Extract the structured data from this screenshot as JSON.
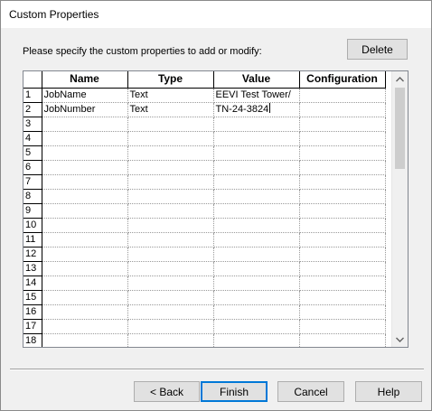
{
  "window": {
    "title": "Custom Properties"
  },
  "prompt": "Please specify the custom properties to add or modify:",
  "buttons": {
    "delete": "Delete",
    "back": "< Back",
    "finish": "Finish",
    "cancel": "Cancel",
    "help": "Help"
  },
  "grid": {
    "columns": [
      "Name",
      "Type",
      "Value",
      "Configuration"
    ],
    "rows": [
      {
        "num": "1",
        "name": "JobName",
        "type": "Text",
        "value": "EEVI Test Tower/",
        "config": ""
      },
      {
        "num": "2",
        "name": "JobNumber",
        "type": "Text",
        "value": "TN-24-3824",
        "config": ""
      },
      {
        "num": "3",
        "name": "",
        "type": "",
        "value": "",
        "config": ""
      },
      {
        "num": "4",
        "name": "",
        "type": "",
        "value": "",
        "config": ""
      },
      {
        "num": "5",
        "name": "",
        "type": "",
        "value": "",
        "config": ""
      },
      {
        "num": "6",
        "name": "",
        "type": "",
        "value": "",
        "config": ""
      },
      {
        "num": "7",
        "name": "",
        "type": "",
        "value": "",
        "config": ""
      },
      {
        "num": "8",
        "name": "",
        "type": "",
        "value": "",
        "config": ""
      },
      {
        "num": "9",
        "name": "",
        "type": "",
        "value": "",
        "config": ""
      },
      {
        "num": "10",
        "name": "",
        "type": "",
        "value": "",
        "config": ""
      },
      {
        "num": "11",
        "name": "",
        "type": "",
        "value": "",
        "config": ""
      },
      {
        "num": "12",
        "name": "",
        "type": "",
        "value": "",
        "config": ""
      },
      {
        "num": "13",
        "name": "",
        "type": "",
        "value": "",
        "config": ""
      },
      {
        "num": "14",
        "name": "",
        "type": "",
        "value": "",
        "config": ""
      },
      {
        "num": "15",
        "name": "",
        "type": "",
        "value": "",
        "config": ""
      },
      {
        "num": "16",
        "name": "",
        "type": "",
        "value": "",
        "config": ""
      },
      {
        "num": "17",
        "name": "",
        "type": "",
        "value": "",
        "config": ""
      },
      {
        "num": "18",
        "name": "",
        "type": "",
        "value": "",
        "config": ""
      }
    ]
  },
  "scrollbar": {
    "up_icon": "chevron-up-icon",
    "down_icon": "chevron-down-icon"
  }
}
